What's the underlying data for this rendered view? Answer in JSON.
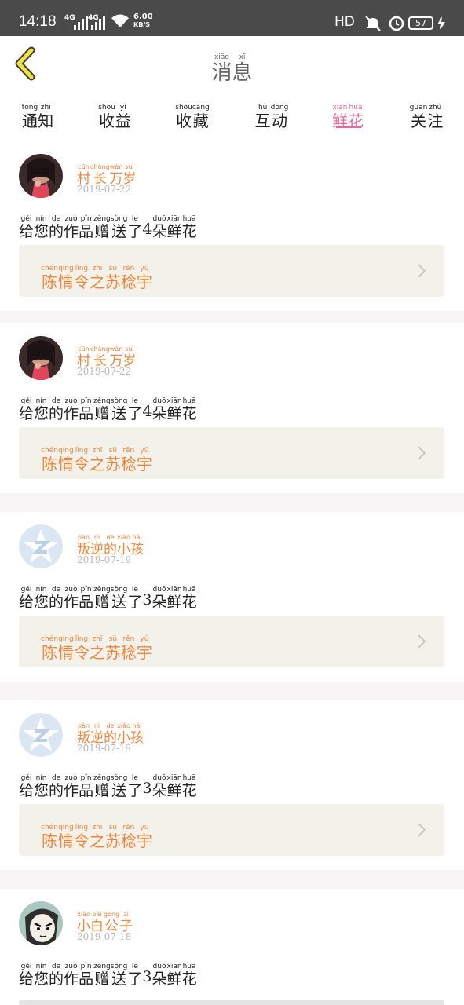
{
  "status_bar": {
    "time": "14:18",
    "signal_1": "4G",
    "signal_2": "4G",
    "speed_value": "6.00",
    "speed_unit": "KB/S",
    "right_label": "HD",
    "battery": "57"
  },
  "header": {
    "title": [
      {
        "py": "xiāo",
        "hz": "消"
      },
      {
        "py": "xī",
        "hz": "息"
      }
    ]
  },
  "tabs": [
    {
      "chars": [
        {
          "py": "tōng",
          "hz": "通"
        },
        {
          "py": "zhī",
          "hz": "知"
        }
      ],
      "active": false
    },
    {
      "chars": [
        {
          "py": "shōu",
          "hz": "收"
        },
        {
          "py": "yì",
          "hz": "益"
        }
      ],
      "active": false
    },
    {
      "chars": [
        {
          "py": "shōu",
          "hz": "收"
        },
        {
          "py": "cáng",
          "hz": "藏"
        }
      ],
      "active": false
    },
    {
      "chars": [
        {
          "py": "hù",
          "hz": "互"
        },
        {
          "py": "dòng",
          "hz": "动"
        }
      ],
      "active": false
    },
    {
      "chars": [
        {
          "py": "xiān",
          "hz": "鲜"
        },
        {
          "py": "huā",
          "hz": "花"
        }
      ],
      "active": true
    },
    {
      "chars": [
        {
          "py": "guān",
          "hz": "关"
        },
        {
          "py": "zhù",
          "hz": "注"
        }
      ],
      "active": false
    }
  ],
  "notifications": [
    {
      "avatar": "photo-avatar-girl",
      "user": [
        {
          "py": "cūn",
          "hz": "村"
        },
        {
          "py": "cháng",
          "hz": "长"
        },
        {
          "py": "wàn",
          "hz": "万"
        },
        {
          "py": "suì",
          "hz": "岁"
        }
      ],
      "date": "2019-07-22",
      "message": [
        {
          "py": "gěi",
          "hz": "给"
        },
        {
          "py": "nín",
          "hz": "您"
        },
        {
          "py": "de",
          "hz": "的"
        },
        {
          "py": "zuò",
          "hz": "作"
        },
        {
          "py": "pǐn",
          "hz": "品"
        },
        {
          "py": "zèng",
          "hz": "赠"
        },
        {
          "py": "sòng",
          "hz": "送"
        },
        {
          "py": "le",
          "hz": "了"
        },
        {
          "py": "",
          "hz": "4"
        },
        {
          "py": "duǒ",
          "hz": "朵"
        },
        {
          "py": "xiān",
          "hz": "鲜"
        },
        {
          "py": "huā",
          "hz": "花"
        }
      ],
      "work": [
        {
          "py": "chén",
          "hz": "陈"
        },
        {
          "py": "qíng",
          "hz": "情"
        },
        {
          "py": "lìng",
          "hz": "令"
        },
        {
          "py": "zhī",
          "hz": "之"
        },
        {
          "py": "sū",
          "hz": "苏"
        },
        {
          "py": "rěn",
          "hz": "稔"
        },
        {
          "py": "yǔ",
          "hz": "宇"
        }
      ]
    },
    {
      "avatar": "photo-avatar-girl",
      "user": [
        {
          "py": "cūn",
          "hz": "村"
        },
        {
          "py": "cháng",
          "hz": "长"
        },
        {
          "py": "wàn",
          "hz": "万"
        },
        {
          "py": "suì",
          "hz": "岁"
        }
      ],
      "date": "2019-07-22",
      "message": [
        {
          "py": "gěi",
          "hz": "给"
        },
        {
          "py": "nín",
          "hz": "您"
        },
        {
          "py": "de",
          "hz": "的"
        },
        {
          "py": "zuò",
          "hz": "作"
        },
        {
          "py": "pǐn",
          "hz": "品"
        },
        {
          "py": "zèng",
          "hz": "赠"
        },
        {
          "py": "sòng",
          "hz": "送"
        },
        {
          "py": "le",
          "hz": "了"
        },
        {
          "py": "",
          "hz": "4"
        },
        {
          "py": "duǒ",
          "hz": "朵"
        },
        {
          "py": "xiān",
          "hz": "鲜"
        },
        {
          "py": "huā",
          "hz": "花"
        }
      ],
      "work": [
        {
          "py": "chén",
          "hz": "陈"
        },
        {
          "py": "qíng",
          "hz": "情"
        },
        {
          "py": "lìng",
          "hz": "令"
        },
        {
          "py": "zhī",
          "hz": "之"
        },
        {
          "py": "sū",
          "hz": "苏"
        },
        {
          "py": "rěn",
          "hz": "稔"
        },
        {
          "py": "yǔ",
          "hz": "宇"
        }
      ]
    },
    {
      "avatar": "default-z-avatar",
      "user": [
        {
          "py": "pàn",
          "hz": "叛"
        },
        {
          "py": "nì",
          "hz": "逆"
        },
        {
          "py": "de",
          "hz": "的"
        },
        {
          "py": "xiǎo",
          "hz": "小"
        },
        {
          "py": "hái",
          "hz": "孩"
        }
      ],
      "date": "2019-07-19",
      "message": [
        {
          "py": "gěi",
          "hz": "给"
        },
        {
          "py": "nín",
          "hz": "您"
        },
        {
          "py": "de",
          "hz": "的"
        },
        {
          "py": "zuò",
          "hz": "作"
        },
        {
          "py": "pǐn",
          "hz": "品"
        },
        {
          "py": "zèng",
          "hz": "赠"
        },
        {
          "py": "sòng",
          "hz": "送"
        },
        {
          "py": "le",
          "hz": "了"
        },
        {
          "py": "",
          "hz": "3"
        },
        {
          "py": "duǒ",
          "hz": "朵"
        },
        {
          "py": "xiān",
          "hz": "鲜"
        },
        {
          "py": "huā",
          "hz": "花"
        }
      ],
      "work": [
        {
          "py": "chén",
          "hz": "陈"
        },
        {
          "py": "qíng",
          "hz": "情"
        },
        {
          "py": "lìng",
          "hz": "令"
        },
        {
          "py": "zhī",
          "hz": "之"
        },
        {
          "py": "sū",
          "hz": "苏"
        },
        {
          "py": "rěn",
          "hz": "稔"
        },
        {
          "py": "yǔ",
          "hz": "宇"
        }
      ]
    },
    {
      "avatar": "default-z-avatar",
      "user": [
        {
          "py": "pàn",
          "hz": "叛"
        },
        {
          "py": "nì",
          "hz": "逆"
        },
        {
          "py": "de",
          "hz": "的"
        },
        {
          "py": "xiǎo",
          "hz": "小"
        },
        {
          "py": "hái",
          "hz": "孩"
        }
      ],
      "date": "2019-07-19",
      "message": [
        {
          "py": "gěi",
          "hz": "给"
        },
        {
          "py": "nín",
          "hz": "您"
        },
        {
          "py": "de",
          "hz": "的"
        },
        {
          "py": "zuò",
          "hz": "作"
        },
        {
          "py": "pǐn",
          "hz": "品"
        },
        {
          "py": "zèng",
          "hz": "赠"
        },
        {
          "py": "sòng",
          "hz": "送"
        },
        {
          "py": "le",
          "hz": "了"
        },
        {
          "py": "",
          "hz": "3"
        },
        {
          "py": "duǒ",
          "hz": "朵"
        },
        {
          "py": "xiān",
          "hz": "鲜"
        },
        {
          "py": "huā",
          "hz": "花"
        }
      ],
      "work": [
        {
          "py": "chén",
          "hz": "陈"
        },
        {
          "py": "qíng",
          "hz": "情"
        },
        {
          "py": "lìng",
          "hz": "令"
        },
        {
          "py": "zhī",
          "hz": "之"
        },
        {
          "py": "sū",
          "hz": "苏"
        },
        {
          "py": "rěn",
          "hz": "稔"
        },
        {
          "py": "yǔ",
          "hz": "宇"
        }
      ]
    },
    {
      "avatar": "cartoon-avatar",
      "user": [
        {
          "py": "xiǎo",
          "hz": "小"
        },
        {
          "py": "bái",
          "hz": "白"
        },
        {
          "py": "gōng",
          "hz": "公"
        },
        {
          "py": "zǐ",
          "hz": "子"
        }
      ],
      "date": "2019-07-18",
      "message": [
        {
          "py": "gěi",
          "hz": "给"
        },
        {
          "py": "nín",
          "hz": "您"
        },
        {
          "py": "de",
          "hz": "的"
        },
        {
          "py": "zuò",
          "hz": "作"
        },
        {
          "py": "pǐn",
          "hz": "品"
        },
        {
          "py": "zèng",
          "hz": "赠"
        },
        {
          "py": "sòng",
          "hz": "送"
        },
        {
          "py": "le",
          "hz": "了"
        },
        {
          "py": "",
          "hz": "3"
        },
        {
          "py": "duǒ",
          "hz": "朵"
        },
        {
          "py": "xiān",
          "hz": "鲜"
        },
        {
          "py": "huā",
          "hz": "花"
        }
      ],
      "work": []
    }
  ],
  "colors": {
    "accent_pink": "#e66aa1",
    "username_orange": "#f0863c",
    "work_box_bg": "#f3f2ea",
    "back_arrow_yellow": "#f2e23d"
  }
}
